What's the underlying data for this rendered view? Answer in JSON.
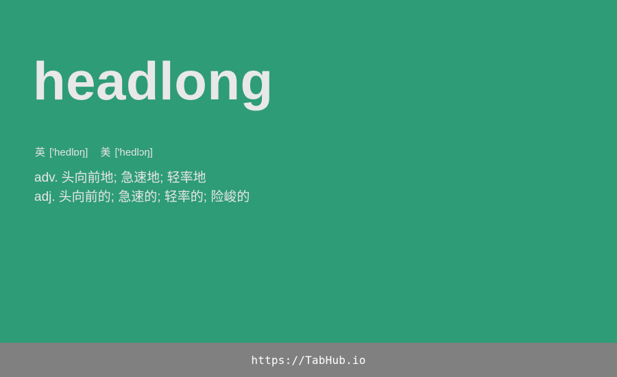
{
  "word": "headlong",
  "phonetics": {
    "uk": {
      "region": "英",
      "ipa": "['hedlɒŋ]"
    },
    "us": {
      "region": "美",
      "ipa": "['hedlɔŋ]"
    }
  },
  "definitions": [
    {
      "pos": "adv.",
      "meaning": "头向前地; 急速地; 轻率地"
    },
    {
      "pos": "adj.",
      "meaning": "头向前的; 急速的; 轻率的; 险峻的"
    }
  ],
  "footer": {
    "link_text": "https://TabHub.io"
  },
  "colors": {
    "card_background": "#2e9c76",
    "footer_background": "#808080",
    "text": "#e8e8e8"
  }
}
